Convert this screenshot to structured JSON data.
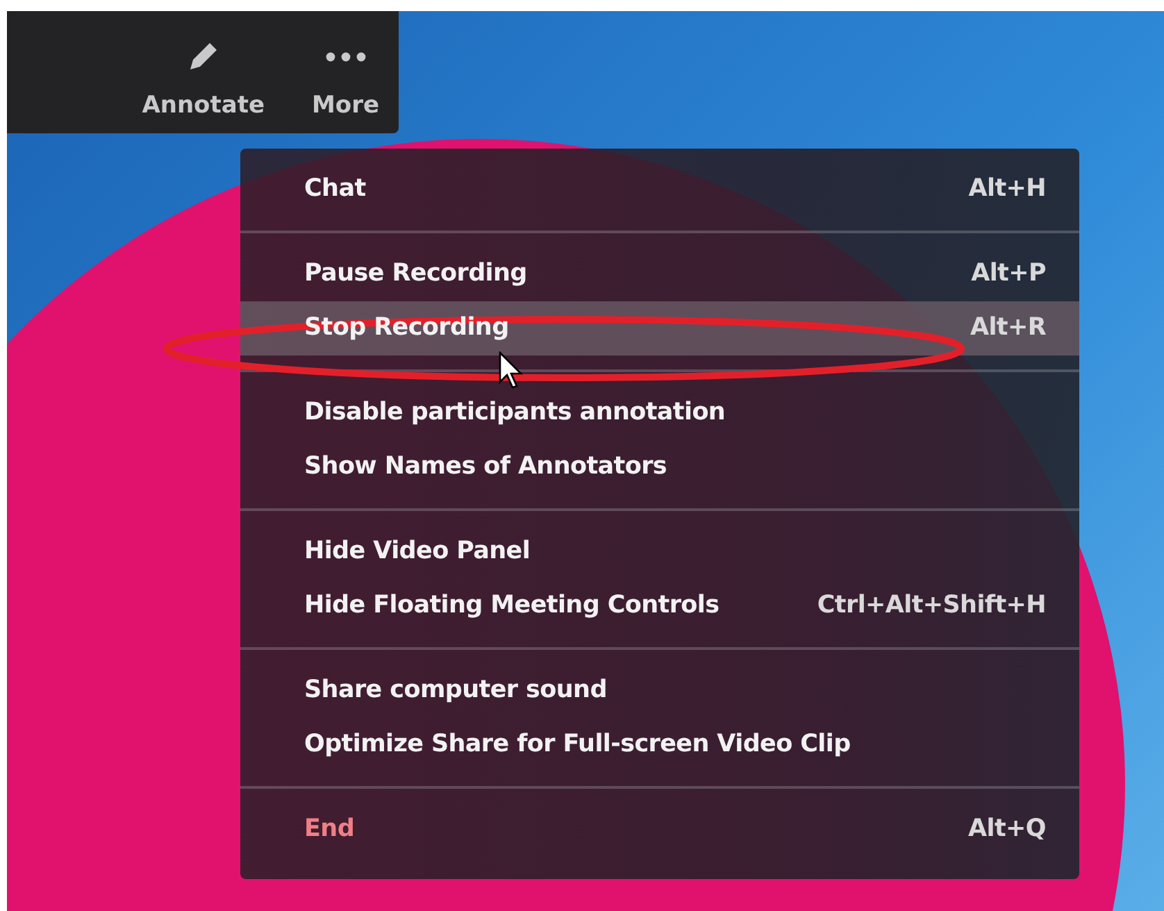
{
  "toolbar": {
    "buttons": [
      {
        "label": "Annotate",
        "kind": "pencil"
      },
      {
        "label": "More",
        "kind": "dots"
      }
    ]
  },
  "menu": {
    "sections": [
      [
        {
          "label": "Chat",
          "shortcut": "Alt+H",
          "highlighted": false,
          "kind": "normal"
        }
      ],
      [
        {
          "label": "Pause Recording",
          "shortcut": "Alt+P",
          "highlighted": false,
          "kind": "normal"
        },
        {
          "label": "Stop Recording",
          "shortcut": "Alt+R",
          "highlighted": true,
          "kind": "normal"
        }
      ],
      [
        {
          "label": "Disable participants annotation",
          "highlighted": false,
          "kind": "normal"
        },
        {
          "label": "Show Names of Annotators",
          "highlighted": false,
          "kind": "normal"
        }
      ],
      [
        {
          "label": "Hide Video Panel",
          "highlighted": false,
          "kind": "normal"
        },
        {
          "label": "Hide Floating Meeting Controls",
          "shortcut": "Ctrl+Alt+Shift+H",
          "highlighted": false,
          "kind": "normal"
        }
      ],
      [
        {
          "label": "Share computer sound",
          "highlighted": false,
          "kind": "normal"
        },
        {
          "label": "Optimize Share for Full-screen Video Clip",
          "highlighted": false,
          "kind": "normal"
        }
      ],
      [
        {
          "label": "End",
          "shortcut": "Alt+Q",
          "highlighted": false,
          "kind": "danger"
        }
      ]
    ]
  }
}
